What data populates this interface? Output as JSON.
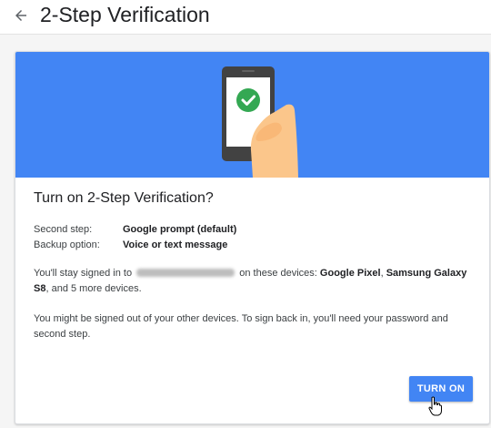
{
  "header": {
    "title": "2-Step Verification",
    "back_icon": "arrow-back-icon"
  },
  "card": {
    "title": "Turn on 2-Step Verification?",
    "illustration": "phone-checkmark-icon",
    "hero_color": "#4285f4",
    "second_step_label": "Second step:",
    "second_step_value": "Google prompt (default)",
    "backup_label": "Backup option:",
    "backup_value": "Voice or text message",
    "signed_in_prefix": "You'll stay signed in to",
    "signed_in_middle": "on these devices:",
    "device_1": "Google Pixel",
    "separator": ",",
    "device_2": "Samsung Galaxy S8",
    "signed_in_suffix": ", and 5 more devices.",
    "signout_note": "You might be signed out of your other devices. To sign back in, you'll need your password and second step.",
    "button_label": "TURN ON"
  }
}
